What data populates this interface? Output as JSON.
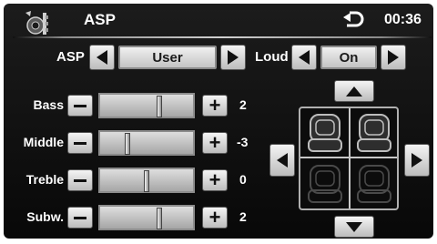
{
  "header": {
    "title": "ASP",
    "clock": "00:36",
    "logo_icon": "asp-logo-icon",
    "back_icon": "back-arrow-icon"
  },
  "asp": {
    "label": "ASP",
    "value": "User"
  },
  "loud": {
    "label": "Loud",
    "value": "On"
  },
  "eq": {
    "rows": [
      {
        "label": "Bass",
        "value": "2",
        "level": 2
      },
      {
        "label": "Middle",
        "value": "-3",
        "level": -3
      },
      {
        "label": "Treble",
        "value": "0",
        "level": 0
      },
      {
        "label": "Subw.",
        "value": "2",
        "level": 2
      }
    ]
  },
  "balance": {
    "active_seats": "front",
    "seat_icon": "car-seat-icon"
  },
  "colors": {
    "background": "#0b0b0b",
    "text": "#ffffff",
    "button": "#d8d8d8"
  }
}
